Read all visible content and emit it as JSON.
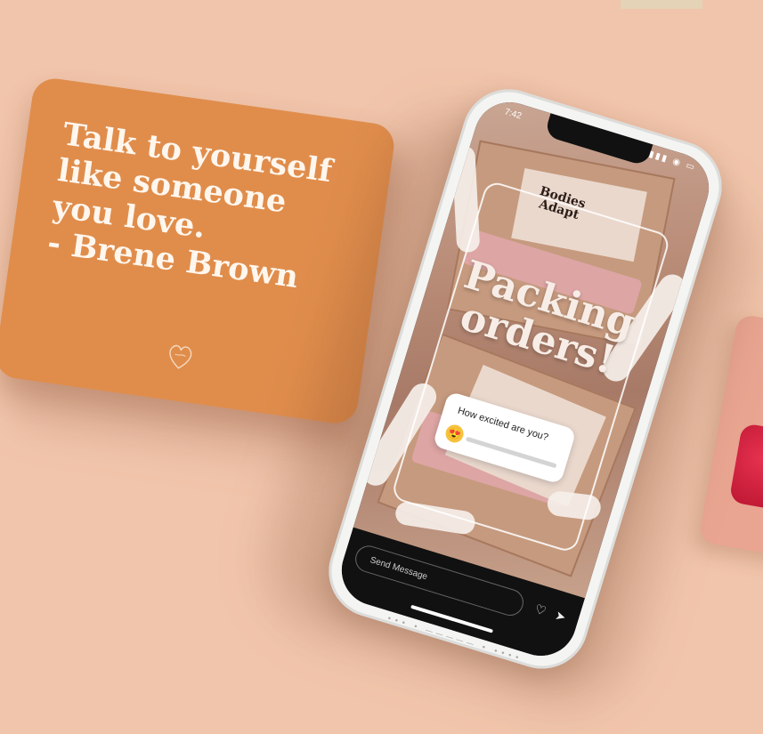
{
  "quote_card": {
    "text": "Talk to yourself\nlike someone\nyou love.\n- Brene Brown"
  },
  "phone": {
    "status": {
      "time": "7:42",
      "icons": "▮▮▮ ◉ ▭"
    },
    "story": {
      "brand_label": "Bodies\nAdapt",
      "headline": "Packing\norders!",
      "poll": {
        "question": "How excited are you?",
        "emoji": "😍",
        "level": 0.0
      }
    },
    "reply_bar": {
      "placeholder": "Send Message",
      "heart": "♡",
      "send": "➤"
    }
  },
  "colors": {
    "background": "#f1c5ab",
    "quote_card": "#e08d4c",
    "quote_text": "#fff7ee",
    "right_card": "#e9a591",
    "glitter": "#c41e3a"
  },
  "icons": [
    "heart-logo-icon",
    "signal-icon",
    "wifi-icon",
    "battery-icon",
    "heart-icon",
    "send-icon",
    "emoji-heart-eyes-icon"
  ]
}
